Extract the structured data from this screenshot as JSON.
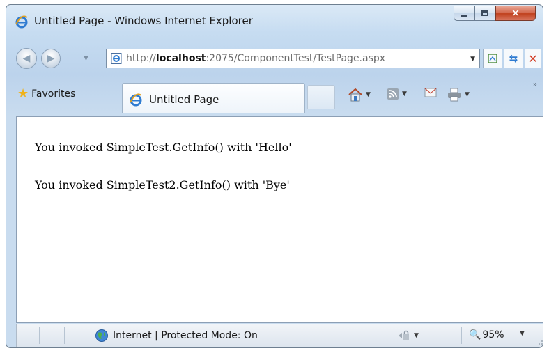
{
  "window": {
    "title": "Untitled Page - Windows Internet Explorer"
  },
  "address_bar": {
    "url_prefix": "http://",
    "url_host": "localhost",
    "url_rest": ":2075/ComponentTest/TestPage.aspx"
  },
  "favorites": {
    "label": "Favorites"
  },
  "tab": {
    "label": "Untitled Page"
  },
  "page": {
    "lines": [
      "You invoked SimpleTest.GetInfo() with 'Hello'",
      "You invoked SimpleTest2.GetInfo() with 'Bye'"
    ]
  },
  "status_bar": {
    "zone": "Internet | Protected Mode: On",
    "zoom": "95%"
  },
  "icons": {
    "browser": "ie-logo-icon",
    "favorites": "star-icon",
    "home": "home-icon",
    "feeds": "rss-feed-icon",
    "mail": "mail-icon",
    "print": "printer-icon",
    "globe": "globe-icon"
  },
  "colors": {
    "close_button": "#c8492a",
    "ie_blue": "#2e7bd1"
  }
}
